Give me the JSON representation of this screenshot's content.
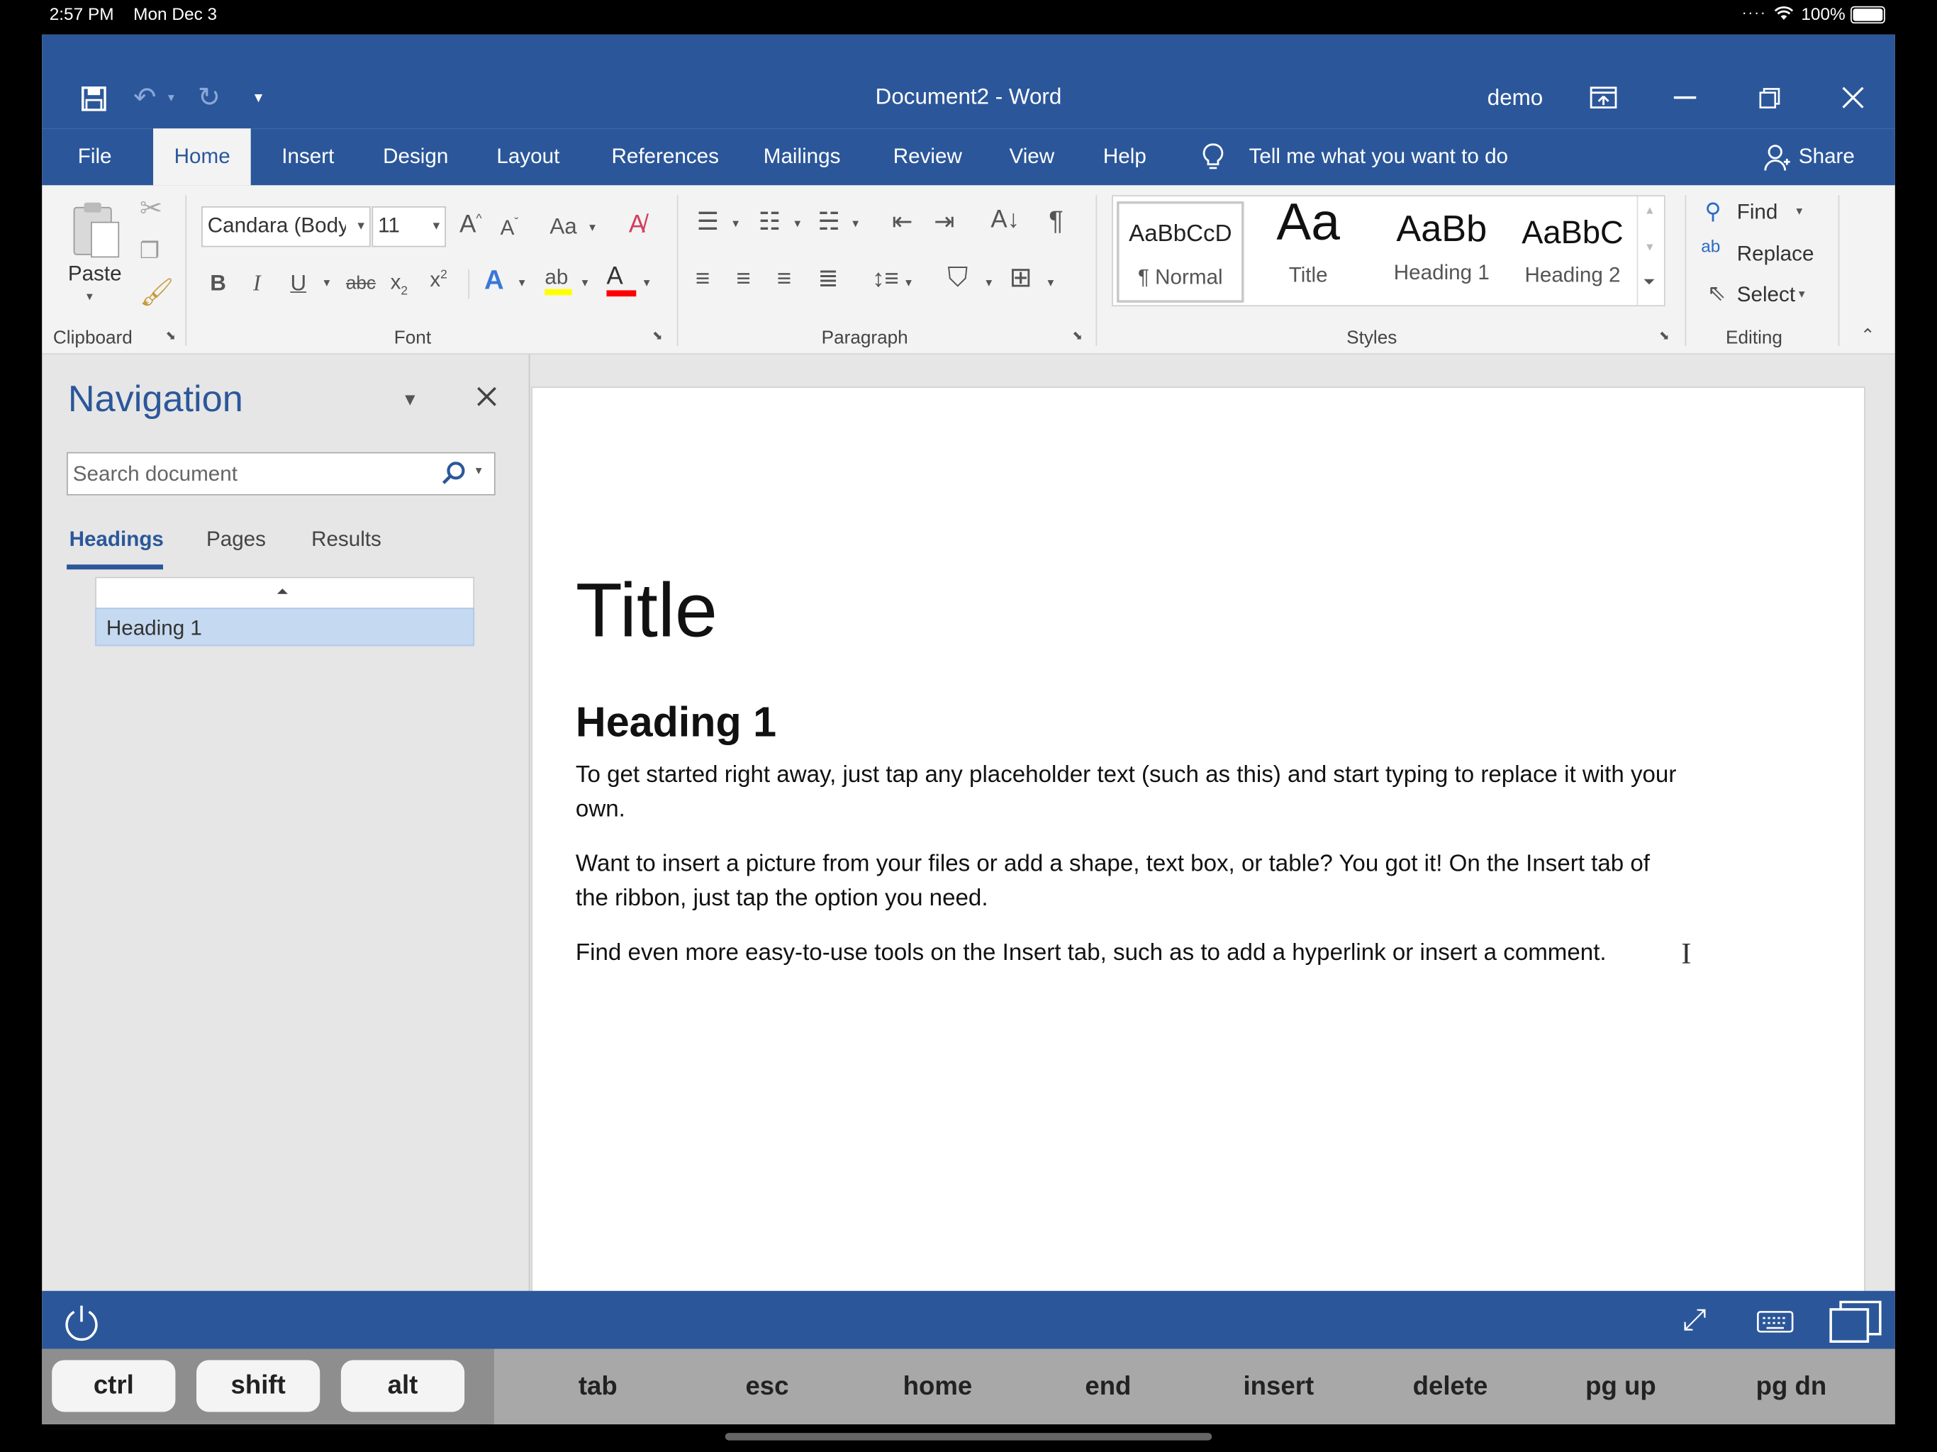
{
  "status_bar": {
    "time": "2:57 PM",
    "date": "Mon Dec 3",
    "battery": "100%"
  },
  "title_bar": {
    "title": "Document2  -  Word",
    "user": "demo",
    "qat_icons": [
      "save-icon",
      "undo-icon",
      "redo-icon",
      "customize-icon"
    ]
  },
  "ribbon_tabs": [
    "File",
    "Home",
    "Insert",
    "Design",
    "Layout",
    "References",
    "Mailings",
    "Review",
    "View",
    "Help"
  ],
  "active_tab": "Home",
  "tell_me": "Tell me what you want to do",
  "share": "Share",
  "clipboard": {
    "paste": "Paste",
    "label": "Clipboard"
  },
  "font": {
    "name": "Candara (Body",
    "size": "11",
    "label": "Font",
    "case": "Aa"
  },
  "paragraph": {
    "label": "Paragraph"
  },
  "styles": {
    "label": "Styles",
    "items": [
      {
        "preview": "AaBbCcD",
        "name": "¶ Normal"
      },
      {
        "preview": "Aa",
        "name": "Title"
      },
      {
        "preview": "AaBb",
        "name": "Heading 1"
      },
      {
        "preview": "AaBbC",
        "name": "Heading 2"
      }
    ]
  },
  "editing": {
    "find": "Find",
    "replace": "Replace",
    "select": "Select",
    "label": "Editing"
  },
  "navigation": {
    "title": "Navigation",
    "search_placeholder": "Search document",
    "tabs": [
      "Headings",
      "Pages",
      "Results"
    ],
    "active_tab": "Headings",
    "headings": [
      "Heading 1"
    ]
  },
  "document": {
    "title": "Title",
    "heading": "Heading 1",
    "paragraphs": [
      "To get started right away, just tap any placeholder text (such as this) and start typing to replace it with your own.",
      "Want to insert a picture from your files or add a shape, text box, or table? You got it! On the Insert tab of the ribbon, just tap the option you need.",
      "Find even more easy-to-use tools on the Insert tab, such as to add a hyperlink or insert a comment."
    ]
  },
  "keyboard": {
    "modifiers": [
      "ctrl",
      "shift",
      "alt"
    ],
    "keys": [
      "tab",
      "esc",
      "home",
      "end",
      "insert",
      "delete",
      "pg up",
      "pg dn"
    ]
  },
  "colors": {
    "word_blue": "#2b579a",
    "highlight": "#ffff00",
    "font_color": "#ff0000"
  }
}
